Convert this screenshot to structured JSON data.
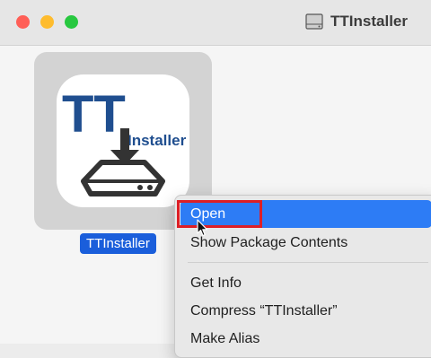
{
  "window": {
    "title": "TTInstaller",
    "icon": "drive-icon",
    "controls": [
      "close",
      "minimize",
      "zoom"
    ]
  },
  "file": {
    "name": "TTInstaller",
    "icon_text_big": "TT",
    "icon_text_small": "Installer",
    "selected": true
  },
  "context_menu": {
    "items": [
      {
        "label": "Open",
        "highlighted": true
      },
      {
        "label": "Show Package Contents"
      },
      {
        "label": "Get Info"
      },
      {
        "label": "Compress “TTInstaller”"
      },
      {
        "label": "Make Alias"
      }
    ]
  },
  "colors": {
    "selection_blue": "#1a5edb",
    "menu_highlight": "#2d7cf5",
    "annotation_red": "#dd1f26",
    "tt_blue": "#1f4e8f",
    "drive_dark": "#333333"
  }
}
